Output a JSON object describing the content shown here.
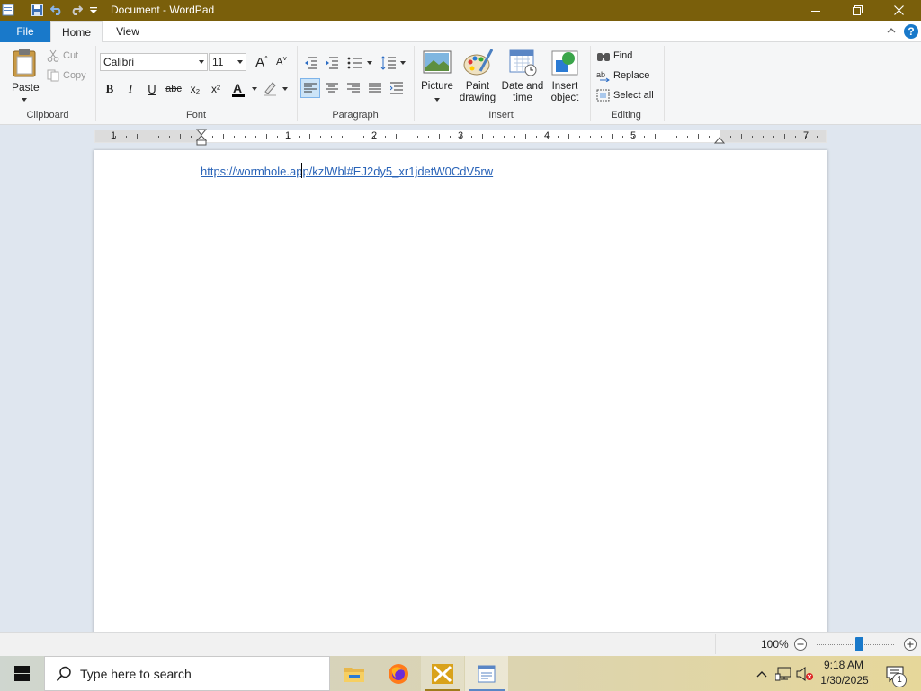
{
  "window": {
    "title": "Document - WordPad"
  },
  "tabs": {
    "file": "File",
    "home": "Home",
    "view": "View"
  },
  "clipboard": {
    "paste": "Paste",
    "cut": "Cut",
    "copy": "Copy",
    "group": "Clipboard"
  },
  "font": {
    "family": "Calibri",
    "size": "11",
    "group": "Font",
    "bold": "B",
    "italic": "I",
    "underline": "U",
    "strike": "abc",
    "subscript": "x₂",
    "superscript": "x²",
    "color_letter": "A",
    "grow": "A",
    "shrink": "A"
  },
  "paragraph": {
    "group": "Paragraph"
  },
  "insert": {
    "picture": "Picture",
    "paint_l1": "Paint",
    "paint_l2": "drawing",
    "date_l1": "Date and",
    "date_l2": "time",
    "object_l1": "Insert",
    "object_l2": "object",
    "group": "Insert"
  },
  "editing": {
    "find": "Find",
    "replace": "Replace",
    "select_all": "Select all",
    "group": "Editing"
  },
  "ruler": {
    "labels": [
      "1",
      "1",
      "2",
      "3",
      "4",
      "5",
      "7"
    ]
  },
  "document": {
    "text": "https://wormhole.app/kzlWbl#EJ2dy5_xr1jdetW0CdV5rw"
  },
  "status": {
    "zoom": "100%",
    "zoom_level": 0.55
  },
  "taskbar": {
    "search_placeholder": "Type here to search",
    "time": "9:18 AM",
    "date": "1/30/2025",
    "notifications": "1"
  },
  "colors": {
    "title_bar": "#7a5f0b",
    "file_tab": "#1979ca",
    "link": "#2a64b8",
    "workspace": "#dfe6ef"
  },
  "icons": [
    "wordpad-app-icon",
    "save-icon",
    "undo-icon",
    "redo-icon",
    "customize-icon",
    "minimize-icon",
    "maximize-icon",
    "close-icon",
    "collapse-ribbon-icon",
    "help-icon",
    "paste-icon",
    "cut-icon",
    "copy-icon",
    "picture-icon",
    "paint-icon",
    "datetime-icon",
    "object-icon",
    "find-icon",
    "replace-icon",
    "select-all-icon",
    "windows-start-icon",
    "search-icon",
    "file-explorer-icon",
    "firefox-icon",
    "app-icon",
    "wordpad-task-icon",
    "chevron-up-icon",
    "network-icon",
    "volume-icon",
    "notifications-icon"
  ]
}
